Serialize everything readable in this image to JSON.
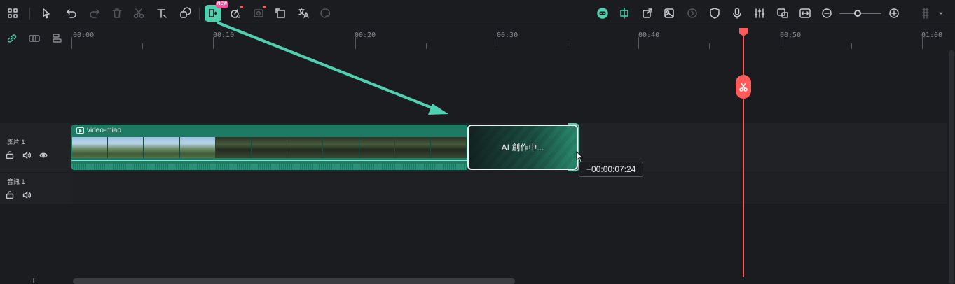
{
  "toolbar": {
    "new_badge": "NEW",
    "icons_left": [
      "grid-icon",
      "select-arrow-icon",
      "undo-icon",
      "redo-icon",
      "delete-icon",
      "cut-icon",
      "text-icon",
      "crop-icon",
      "ai-clip-extend-icon",
      "ai-audio-icon",
      "ai-object-icon",
      "transform-icon",
      "translate-icon",
      "ai-palette-icon"
    ],
    "icons_right": [
      "ai-robot-icon",
      "snap-icon",
      "export-icon",
      "image-icon",
      "speed-icon",
      "shield-icon",
      "mic-icon",
      "mixer-icon",
      "replace-icon",
      "fit-icon",
      "zoom-out-icon",
      "zoom-in-icon",
      "layout-icon"
    ]
  },
  "ruler": {
    "labels": [
      "00:00",
      "00:10",
      "00:20",
      "00:30",
      "00:40",
      "00:50",
      "01:00"
    ]
  },
  "tracks": {
    "video_label": "影片 1",
    "audio_label": "音訊 1"
  },
  "clip": {
    "name": "video-miao"
  },
  "ai_block": {
    "text": "AI 創作中..."
  },
  "tooltip": {
    "time": "+00:00:07:24"
  },
  "add_track": "+",
  "colors": {
    "accent": "#4fd1b0",
    "playhead": "#ff5a5a",
    "clip": "#1f7a64",
    "background": "#1b1c20"
  }
}
